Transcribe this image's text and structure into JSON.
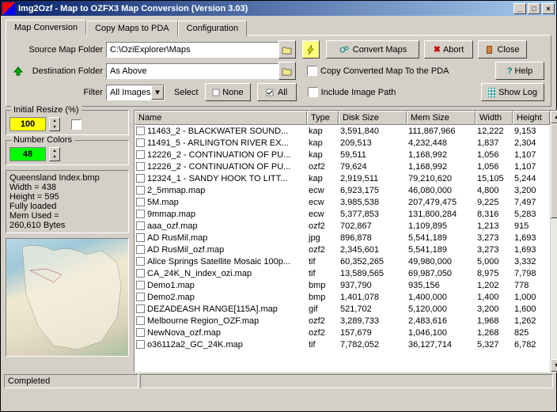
{
  "window": {
    "title": "Img2Ozf - Map to OZFX3 Map Conversion (Version 3.03)"
  },
  "tabs": {
    "t1": "Map Conversion",
    "t2": "Copy Maps to PDA",
    "t3": "Configuration"
  },
  "form": {
    "srcLabel": "Source Map Folder",
    "srcValue": "C:\\OziExplorer\\Maps",
    "dstLabel": "Destination Folder",
    "dstValue": "As Above",
    "filterLabel": "Filter",
    "filterValue": "All Images",
    "selectLabel": "Select",
    "noneBtn": "None",
    "allBtn": "All",
    "convertBtn": "Convert Maps",
    "abortBtn": "Abort",
    "closeBtn": "Close",
    "helpBtn": "Help",
    "showLogBtn": "Show Log",
    "copyPdaLabel": "Copy Converted Map To the PDA",
    "incImgLabel": "Include Image Path"
  },
  "left": {
    "resizeLegend": "Initial Resize (%)",
    "resizeValue": "100",
    "colorsLegend": "Number Colors",
    "colorsValue": "48",
    "info1": "Queensland Index.bmp",
    "info2": "Width = 438",
    "info3": "Height = 595",
    "info4": "Fully loaded",
    "info5": "Mem Used =",
    "info6": "260,610 Bytes"
  },
  "cols": {
    "name": "Name",
    "type": "Type",
    "disk": "Disk Size",
    "mem": "Mem Size",
    "width": "Width",
    "height": "Height"
  },
  "rows": [
    {
      "name": "11463_2 - BLACKWATER SOUND...",
      "type": "kap",
      "disk": "3,591,840",
      "mem": "111,867,966",
      "width": "12,222",
      "height": "9,153"
    },
    {
      "name": "11491_5 - ARLINGTON RIVER EX...",
      "type": "kap",
      "disk": "209,513",
      "mem": "4,232,448",
      "width": "1,837",
      "height": "2,304"
    },
    {
      "name": "12226_2 - CONTINUATION OF PU...",
      "type": "kap",
      "disk": "59,511",
      "mem": "1,168,992",
      "width": "1,056",
      "height": "1,107"
    },
    {
      "name": "12226_2 - CONTINUATION OF PU...",
      "type": "ozf2",
      "disk": "79,624",
      "mem": "1,168,992",
      "width": "1,056",
      "height": "1,107"
    },
    {
      "name": "12324_1 - SANDY HOOK TO LITT...",
      "type": "kap",
      "disk": "2,919,511",
      "mem": "79,210,620",
      "width": "15,105",
      "height": "5,244"
    },
    {
      "name": "2_5mmap.map",
      "type": "ecw",
      "disk": "6,923,175",
      "mem": "46,080,000",
      "width": "4,800",
      "height": "3,200"
    },
    {
      "name": "5M.map",
      "type": "ecw",
      "disk": "3,985,538",
      "mem": "207,479,475",
      "width": "9,225",
      "height": "7,497"
    },
    {
      "name": "9mmap.map",
      "type": "ecw",
      "disk": "5,377,853",
      "mem": "131,800,284",
      "width": "8,316",
      "height": "5,283"
    },
    {
      "name": "aaa_ozf.map",
      "type": "ozf2",
      "disk": "702,867",
      "mem": "1,109,895",
      "width": "1,213",
      "height": "915"
    },
    {
      "name": "AD RusMil.map",
      "type": "jpg",
      "disk": "896,878",
      "mem": "5,541,189",
      "width": "3,273",
      "height": "1,693"
    },
    {
      "name": "AD RusMil_ozf.map",
      "type": "ozf2",
      "disk": "2,345,601",
      "mem": "5,541,189",
      "width": "3,273",
      "height": "1,693"
    },
    {
      "name": "Alice Springs Satellite Mosaic 100p...",
      "type": "tif",
      "disk": "60,352,265",
      "mem": "49,980,000",
      "width": "5,000",
      "height": "3,332"
    },
    {
      "name": "CA_24K_N_index_ozi.map",
      "type": "tif",
      "disk": "13,589,565",
      "mem": "69,987,050",
      "width": "8,975",
      "height": "7,798"
    },
    {
      "name": "Demo1.map",
      "type": "bmp",
      "disk": "937,790",
      "mem": "935,156",
      "width": "1,202",
      "height": "778"
    },
    {
      "name": "Demo2.map",
      "type": "bmp",
      "disk": "1,401,078",
      "mem": "1,400,000",
      "width": "1,400",
      "height": "1,000"
    },
    {
      "name": "DEZADEASH RANGE[115A].map",
      "type": "gif",
      "disk": "521,702",
      "mem": "5,120,000",
      "width": "3,200",
      "height": "1,600"
    },
    {
      "name": "Melbourne Region_OZF.map",
      "type": "ozf2",
      "disk": "3,289,733",
      "mem": "2,483,616",
      "width": "1,968",
      "height": "1,262"
    },
    {
      "name": "NewNova_ozf.map",
      "type": "ozf2",
      "disk": "157,679",
      "mem": "1,046,100",
      "width": "1,268",
      "height": "825"
    },
    {
      "name": "o36112a2_GC_24K.map",
      "type": "tif",
      "disk": "7,782,052",
      "mem": "36,127,714",
      "width": "5,327",
      "height": "6,782"
    }
  ],
  "status": {
    "text": "Completed"
  }
}
